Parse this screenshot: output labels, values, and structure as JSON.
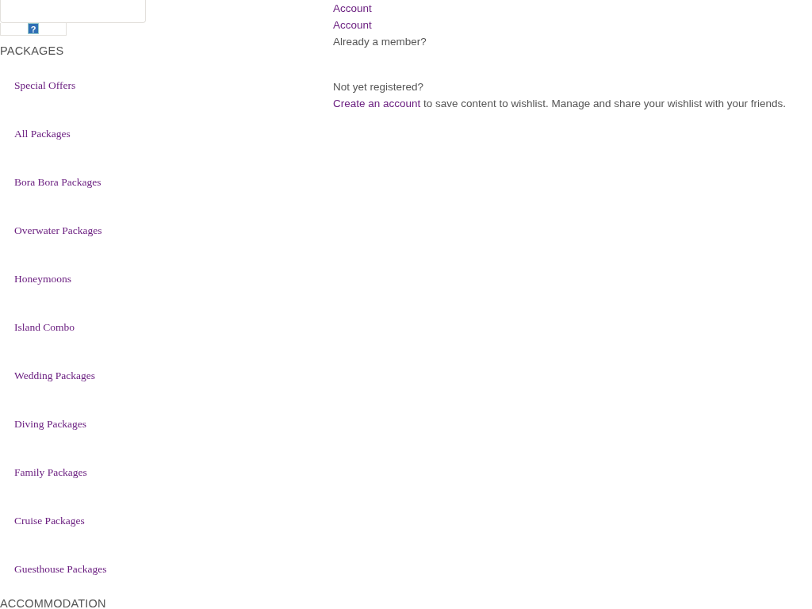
{
  "top_widget": {
    "help_icon": "?"
  },
  "sidebar": {
    "sections": [
      {
        "heading": "PACKAGES",
        "items": [
          "Special Offers",
          "All Packages",
          "Bora Bora Packages",
          "Overwater Packages",
          "Honeymoons",
          "Island Combo",
          "Wedding Packages",
          "Diving Packages",
          "Family Packages",
          "Cruise Packages",
          "Guesthouse Packages"
        ]
      },
      {
        "heading": "ACCOMMODATION"
      }
    ]
  },
  "account": {
    "links": [
      "Account",
      "Account"
    ],
    "member_prompt": "Already a member?",
    "register_prompt": "Not yet registered?",
    "create_link": "Create an account",
    "create_text": " to save content to wishlist. Manage and share your wishlist with your friends."
  }
}
